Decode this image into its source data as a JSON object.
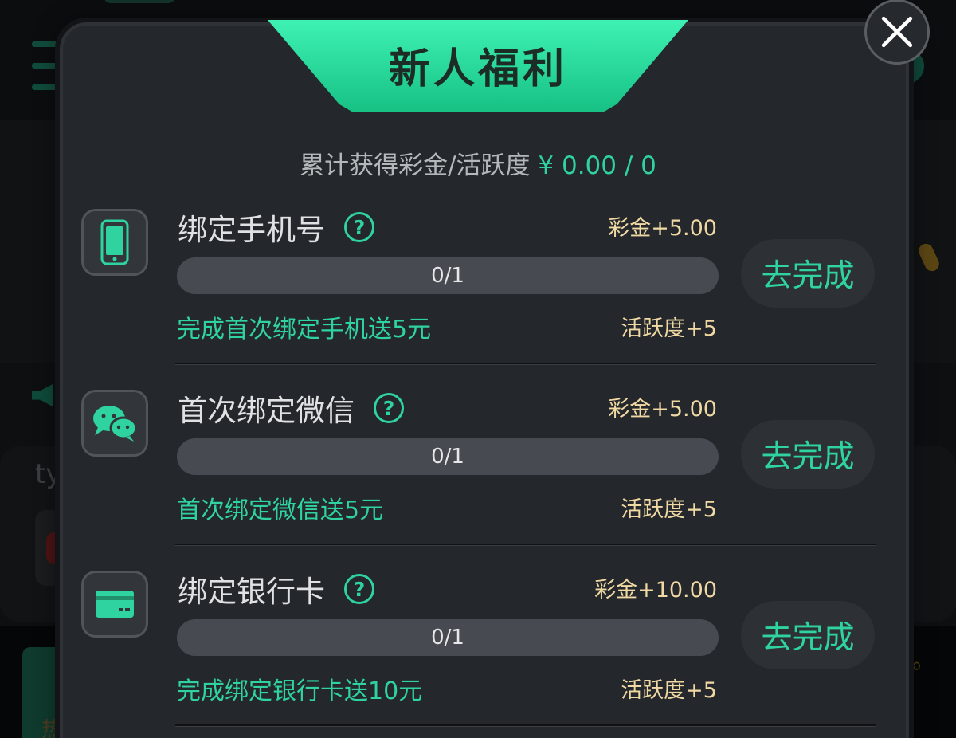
{
  "modal": {
    "title": "新人福利",
    "summary_label": "累计获得彩金/活跃度",
    "summary_value": "¥ 0.00 / 0"
  },
  "tasks": [
    {
      "title": "绑定手机号",
      "icon": "phone-icon",
      "reward": "彩金+5.00",
      "progress": "0/1",
      "progress_fraction": 0,
      "description": "完成首次绑定手机送5元",
      "activity": "活跃度+5",
      "button": "去完成"
    },
    {
      "title": "首次绑定微信",
      "icon": "wechat-icon",
      "reward": "彩金+5.00",
      "progress": "0/1",
      "progress_fraction": 0,
      "description": "首次绑定微信送5元",
      "activity": "活跃度+5",
      "button": "去完成"
    },
    {
      "title": "绑定银行卡",
      "icon": "bank-card-icon",
      "reward": "彩金+10.00",
      "progress": "0/1",
      "progress_fraction": 0,
      "description": "完成绑定银行卡送10元",
      "activity": "活跃度+5",
      "button": "去完成"
    }
  ],
  "background": {
    "partial_text": "ty",
    "hot_label": "热",
    "infinity_glyph": "∞"
  },
  "colors": {
    "accent": "#2fd39f",
    "reward_gold": "#f0d9a3",
    "panel": "#24272c"
  }
}
